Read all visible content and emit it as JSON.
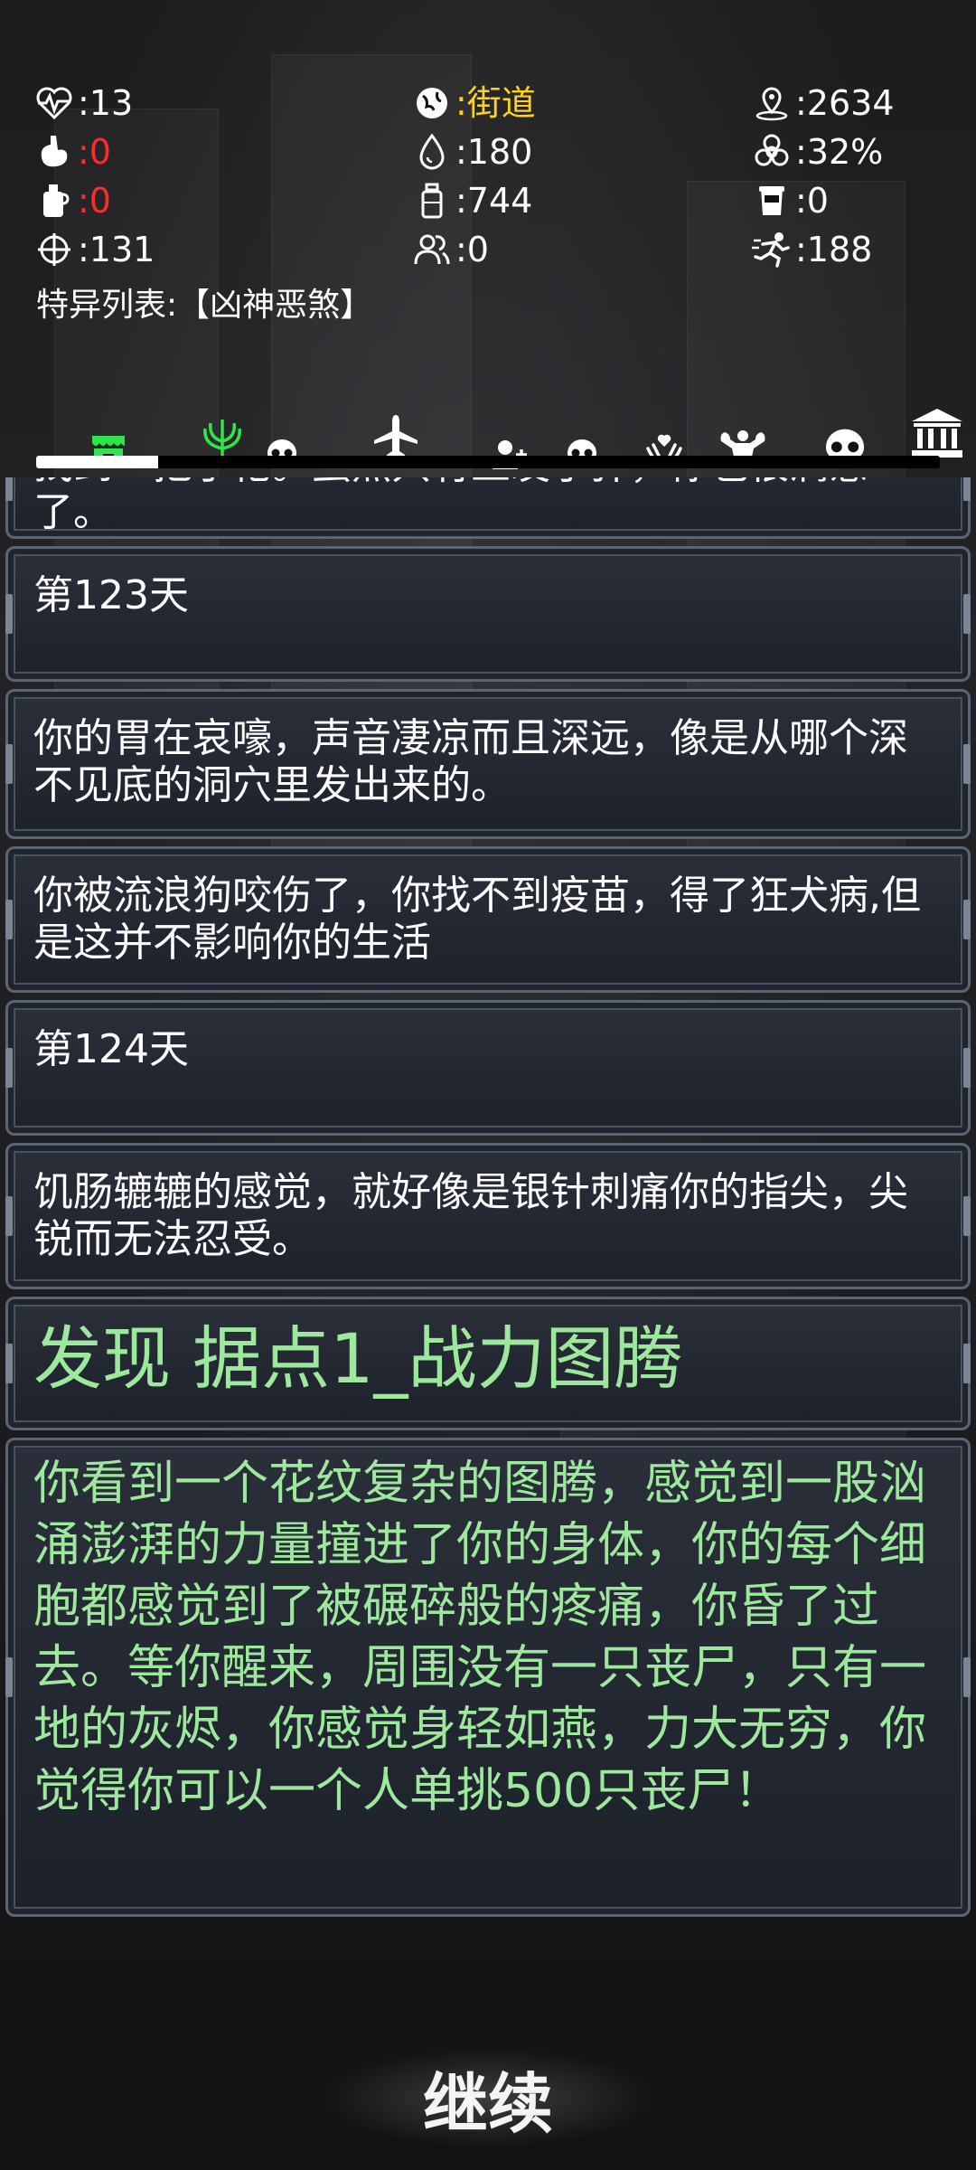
{
  "stats": {
    "health": ":13",
    "location": ":街道",
    "distance": ":2634",
    "hunger": ":0",
    "water": ":180",
    "infection": ":32%",
    "thirst": ":0",
    "bottle": ":744",
    "cup": ":0",
    "attack": ":131",
    "companions": ":0",
    "speed": ":188"
  },
  "traits_label": "特异列表:【凶神恶煞】",
  "tabs": [
    {
      "icon": "shop-icon",
      "color": "#2ee64b"
    },
    {
      "icon": "trident-icon",
      "color": "#2ee64b"
    },
    {
      "icon": "skull-icon",
      "color": "#ffffff"
    },
    {
      "icon": "airplane-icon",
      "color": "#ffffff"
    },
    {
      "icon": "add-user-icon",
      "color": "#ffffff"
    },
    {
      "icon": "skull-icon",
      "color": "#ffffff"
    },
    {
      "icon": "hand-heart-icon",
      "color": "#ffffff"
    },
    {
      "icon": "muscle-icon",
      "color": "#ffffff"
    },
    {
      "icon": "skull-icon",
      "color": "#ffffff"
    },
    {
      "icon": "bank-icon",
      "color": "#ffffff"
    }
  ],
  "progress_fraction": 0.135,
  "log": [
    {
      "text": "找到一把手枪。虽然只有五发子弹，你也很满意了。",
      "style": "normal"
    },
    {
      "text": "第123天",
      "style": "normal"
    },
    {
      "text": "你的胃在哀嚎，声音凄凉而且深远，像是从哪个深不见底的洞穴里发出来的。",
      "style": "normal"
    },
    {
      "text": "你被流浪狗咬伤了，你找不到疫苗，得了狂犬病,但是这并不影响你的生活",
      "style": "normal"
    },
    {
      "text": "第124天",
      "style": "normal"
    },
    {
      "text": "饥肠辘辘的感觉，就好像是银针刺痛你的指尖，尖锐而无法忍受。",
      "style": "normal"
    },
    {
      "text": "发现 据点1_战力图腾",
      "style": "big"
    },
    {
      "text": "你看到一个花纹复杂的图腾，感觉到一股汹涌澎湃的力量撞进了你的身体，你的每个细胞都感觉到了被碾碎般的疼痛，你昏了过去。等你醒来，周围没有一只丧尸，只有一地的灰烬，你感觉身轻如燕，力大无穷，你觉得你可以一个人单挑500只丧尸！",
      "style": "green"
    }
  ],
  "continue_label": "继续"
}
